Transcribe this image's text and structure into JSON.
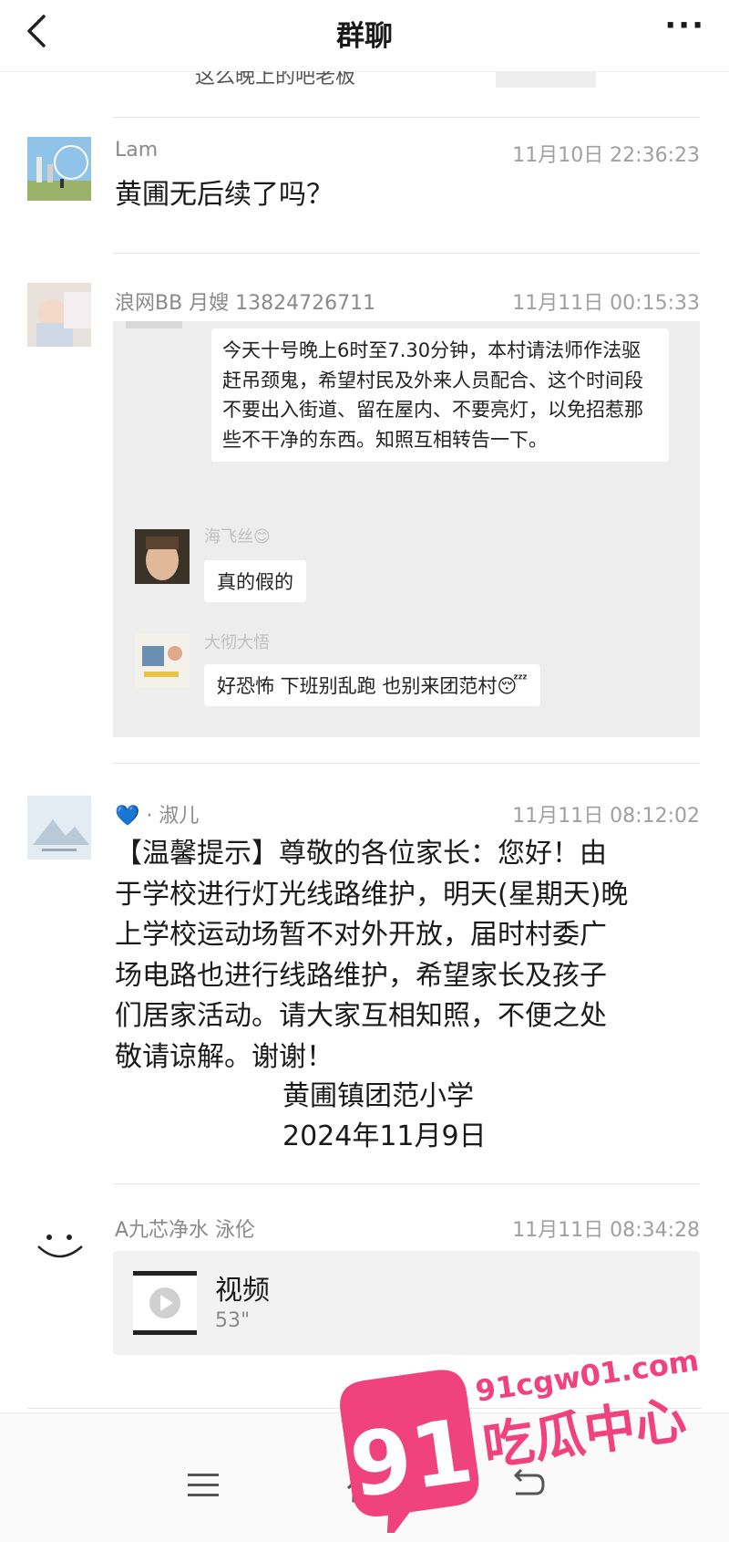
{
  "header": {
    "title": "群聊",
    "back_icon": "chevron-left-icon",
    "more_label": "···"
  },
  "previous_message": {
    "partial_text": "这么晚上的吧老板"
  },
  "messages": [
    {
      "sender": "Lam",
      "time": "11月10日 22:36:23",
      "text": "黄圃无后续了吗？"
    },
    {
      "sender": "浪网BB 月嫂 13824726711",
      "time": "11月11日 00:15:33",
      "embedded_chat": {
        "first_message": "今天十号晚上6时至7.30分钟，本村请法师作法驱赶吊颈鬼，希望村民及外来人员配合、这个时间段不要出入街道、留在屋内、不要亮灯，以免招惹那些不干净的东西。知照互相转告一下。",
        "replies": [
          {
            "sender": "海飞丝😊",
            "text": "真的假的"
          },
          {
            "sender": "大彻大悟",
            "text": "好恐怖 下班别乱跑  也别来团范村😴"
          }
        ]
      }
    },
    {
      "sender": "💙 · 淑儿",
      "time": "11月11日 08:12:02",
      "lines": [
        "【温馨提示】尊敬的各位家长：您好！由",
        "于学校进行灯光线路维护，明天(星期天)晚",
        "上学校运动场暂不对外开放，届时村委广",
        "场电路也进行线路维护，希望家长及孩子",
        "们居家活动。请大家互相知照，不便之处",
        "敬请谅解。谢谢！"
      ],
      "signature": "黄圃镇团范小学",
      "date": "2024年11月9日"
    },
    {
      "sender": "A九芯净水 泳伦",
      "time": "11月11日 08:34:28",
      "video": {
        "title": "视频",
        "duration": "53\""
      }
    }
  ],
  "bottom_nav": {
    "icons": [
      "menu-icon",
      "home-icon",
      "back-arrow-icon"
    ]
  },
  "watermark": {
    "number": "91",
    "url": "91cgw01.com",
    "name": "吃瓜中心",
    "color": "#f0437e"
  }
}
